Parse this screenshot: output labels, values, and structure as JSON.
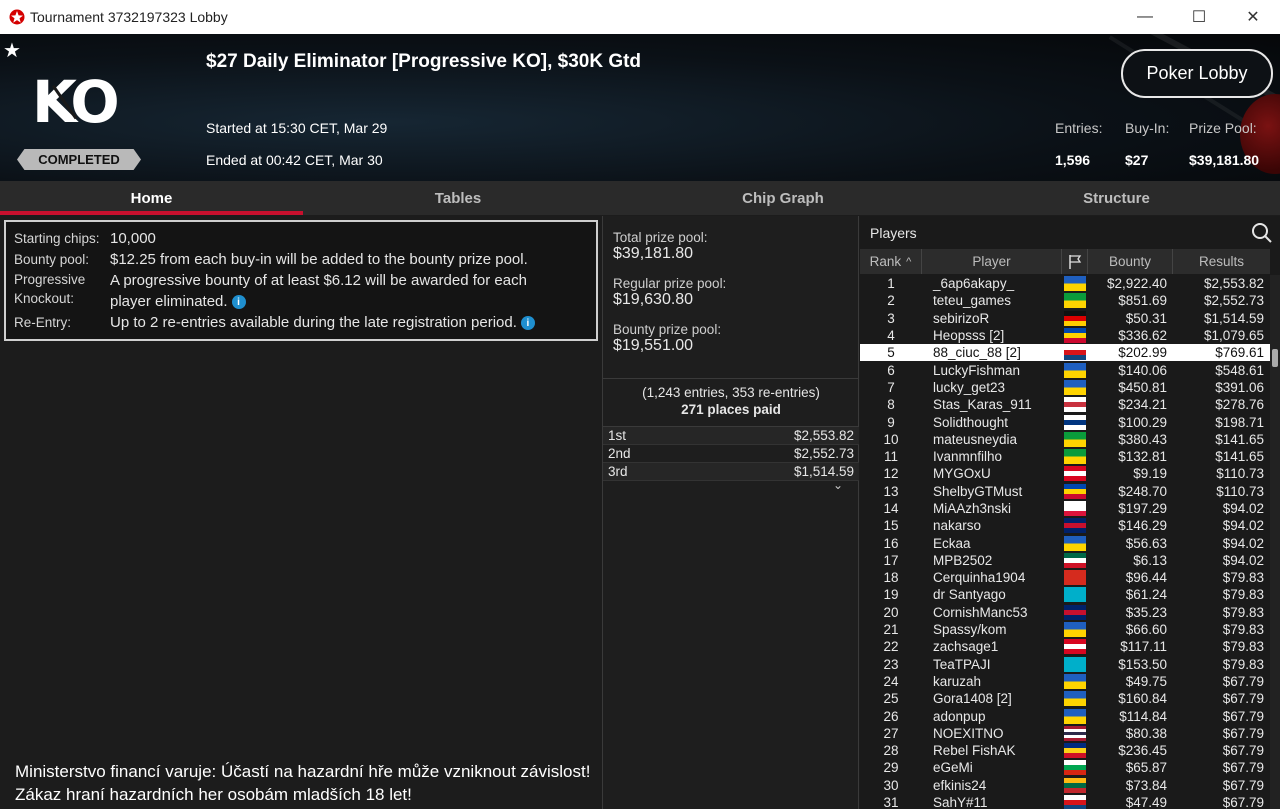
{
  "window": {
    "title": "Tournament 3732197323 Lobby",
    "minimize": "—",
    "maximize": "☐",
    "close": "✕"
  },
  "header": {
    "star": "★",
    "logo_text": "KO",
    "status_badge": "COMPLETED",
    "tournament_name": "$27 Daily Eliminator [Progressive KO], $30K Gtd",
    "started": "Started at 15:30 CET, Mar 29",
    "ended": "Ended at 00:42 CET, Mar 30",
    "lobby_button": "Poker Lobby",
    "stats": {
      "entries_label": "Entries:",
      "entries_value": "1,596",
      "buyin_label": "Buy-In:",
      "buyin_value": "$27",
      "prizepool_label": "Prize Pool:",
      "prizepool_value": "$39,181.80"
    }
  },
  "tabs": [
    "Home",
    "Tables",
    "Chip Graph",
    "Structure"
  ],
  "info": {
    "starting_chips_label": "Starting chips:",
    "starting_chips_value": "10,000",
    "bounty_pool_label": "Bounty pool:",
    "bounty_pool_value": "$12.25 from each buy-in will be added to the bounty prize pool.",
    "progressive_label_1": "Progressive",
    "progressive_label_2": "Knockout:",
    "progressive_value_1": "A progressive bounty of at least $6.12 will be awarded for each",
    "progressive_value_2": "player eliminated.",
    "reentry_label": "Re-Entry:",
    "reentry_value": "Up to 2 re-entries available during the late registration period.",
    "info_glyph": "i"
  },
  "warning": {
    "line1": "Ministerstvo financí varuje: Účastí na hazardní hře může vzniknout závislost!",
    "line2": "Zákaz hraní hazardních her osobám mladších 18 let!"
  },
  "prizes": {
    "total_label": "Total prize pool:",
    "total_value": "$39,181.80",
    "regular_label": "Regular prize pool:",
    "regular_value": "$19,630.80",
    "bounty_label": "Bounty prize pool:",
    "bounty_value": "$19,551.00",
    "entries_text": "(1,243 entries, 353 re-entries)",
    "places_paid": "271 places paid",
    "payouts": [
      {
        "place": "1st",
        "amount": "$2,553.82"
      },
      {
        "place": "2nd",
        "amount": "$2,552.73"
      },
      {
        "place": "3rd",
        "amount": "$1,514.59"
      }
    ],
    "chevron": "⌄"
  },
  "players": {
    "title": "Players",
    "columns": {
      "rank": "Rank",
      "sort_arrow": "^",
      "player": "Player",
      "bounty": "Bounty",
      "results": "Results"
    },
    "rows": [
      {
        "rank": "1",
        "player": "_6ap6akapy_",
        "flag": [
          "#1f5fbf",
          "#ffd400"
        ],
        "bounty": "$2,922.40",
        "results": "$2,553.82"
      },
      {
        "rank": "2",
        "player": "teteu_games",
        "flag": [
          "#0a9b3b",
          "#ffd400"
        ],
        "bounty": "$851.69",
        "results": "$2,552.73"
      },
      {
        "rank": "3",
        "player": "sebirizoR",
        "flag": [
          "#111111",
          "#dd0000",
          "#ffce00"
        ],
        "bounty": "$50.31",
        "results": "$1,514.59"
      },
      {
        "rank": "4",
        "player": "Heopsss [2]",
        "flag": [
          "#0046ae",
          "#ffd200",
          "#cc092f"
        ],
        "bounty": "$336.62",
        "results": "$1,079.65"
      },
      {
        "rank": "5",
        "player": "88_ciuc_88 [2]",
        "flag": [
          "#ffffff",
          "#d7141a",
          "#11457e"
        ],
        "bounty": "$202.99",
        "results": "$769.61",
        "highlight": true
      },
      {
        "rank": "6",
        "player": "LuckyFishman",
        "flag": [
          "#1f5fbf",
          "#ffd400"
        ],
        "bounty": "$140.06",
        "results": "$548.61"
      },
      {
        "rank": "7",
        "player": "lucky_get23",
        "flag": [
          "#1f5fbf",
          "#ffd400"
        ],
        "bounty": "$450.81",
        "results": "$391.06"
      },
      {
        "rank": "8",
        "player": "Stas_Karas_911",
        "flag": [
          "#ffffff",
          "#c8313e",
          "#ffffff"
        ],
        "bounty": "$234.21",
        "results": "$278.76"
      },
      {
        "rank": "9",
        "player": "Solidthought",
        "flag": [
          "#ffffff",
          "#003580",
          "#ffffff"
        ],
        "bounty": "$100.29",
        "results": "$198.71"
      },
      {
        "rank": "10",
        "player": "mateusneydia",
        "flag": [
          "#0a9b3b",
          "#ffd400"
        ],
        "bounty": "$380.43",
        "results": "$141.65"
      },
      {
        "rank": "11",
        "player": "Ivanmnfilho",
        "flag": [
          "#0a9b3b",
          "#ffd400"
        ],
        "bounty": "$132.81",
        "results": "$141.65"
      },
      {
        "rank": "12",
        "player": "MYGOxU",
        "flag": [
          "#d80621",
          "#ffffff",
          "#d80621"
        ],
        "bounty": "$9.19",
        "results": "$110.73"
      },
      {
        "rank": "13",
        "player": "ShelbyGTMust",
        "flag": [
          "#0046ae",
          "#ffd200",
          "#cc092f"
        ],
        "bounty": "$248.70",
        "results": "$110.73"
      },
      {
        "rank": "14",
        "player": "MiAAzh3nski",
        "flag": [
          "#ffffff",
          "#ffffff",
          "#dc143c"
        ],
        "bounty": "$197.29",
        "results": "$94.02"
      },
      {
        "rank": "15",
        "player": "nakarso",
        "flag": [
          "#012169",
          "#c8102e",
          "#012169"
        ],
        "bounty": "$146.29",
        "results": "$94.02"
      },
      {
        "rank": "16",
        "player": "Eckaa",
        "flag": [
          "#1f5fbf",
          "#ffd400"
        ],
        "bounty": "$56.63",
        "results": "$94.02"
      },
      {
        "rank": "17",
        "player": "MPB2502",
        "flag": [
          "#006847",
          "#ffffff",
          "#ce1126"
        ],
        "bounty": "$6.13",
        "results": "$94.02"
      },
      {
        "rank": "18",
        "player": "Cerquinha1904",
        "flag": [
          "#d52b1e",
          "#d52b1e"
        ],
        "bounty": "$96.44",
        "results": "$79.83"
      },
      {
        "rank": "19",
        "player": "dr Santyago",
        "flag": [
          "#00afca",
          "#00afca"
        ],
        "bounty": "$61.24",
        "results": "$79.83"
      },
      {
        "rank": "20",
        "player": "CornishManc53",
        "flag": [
          "#012169",
          "#c8102e",
          "#012169"
        ],
        "bounty": "$35.23",
        "results": "$79.83"
      },
      {
        "rank": "21",
        "player": "Spassy/kom",
        "flag": [
          "#1f5fbf",
          "#ffd400"
        ],
        "bounty": "$66.60",
        "results": "$79.83"
      },
      {
        "rank": "22",
        "player": "zachsage1",
        "flag": [
          "#d80621",
          "#ffffff",
          "#d80621"
        ],
        "bounty": "$117.11",
        "results": "$79.83"
      },
      {
        "rank": "23",
        "player": "TeaTPAJI",
        "flag": [
          "#00afca",
          "#00afca"
        ],
        "bounty": "$153.50",
        "results": "$79.83"
      },
      {
        "rank": "24",
        "player": "karuzah",
        "flag": [
          "#1f5fbf",
          "#ffd400"
        ],
        "bounty": "$49.75",
        "results": "$67.79"
      },
      {
        "rank": "25",
        "player": "Gora1408 [2]",
        "flag": [
          "#1f5fbf",
          "#ffd400"
        ],
        "bounty": "$160.84",
        "results": "$67.79"
      },
      {
        "rank": "26",
        "player": "adonpup",
        "flag": [
          "#1f5fbf",
          "#ffd400"
        ],
        "bounty": "$114.84",
        "results": "$67.79"
      },
      {
        "rank": "27",
        "player": "NOEXITNO",
        "flag": [
          "#a51931",
          "#ffffff",
          "#2d2a4a",
          "#ffffff",
          "#a51931"
        ],
        "bounty": "$80.38",
        "results": "$67.79"
      },
      {
        "rank": "28",
        "player": "Rebel FishAK",
        "flag": [
          "#002b7f",
          "#fcd116",
          "#ce1126"
        ],
        "bounty": "$236.45",
        "results": "$67.79"
      },
      {
        "rank": "29",
        "player": "eGeMi",
        "flag": [
          "#ffffff",
          "#00a651",
          "#d62612"
        ],
        "bounty": "$65.87",
        "results": "$67.79"
      },
      {
        "rank": "30",
        "player": "efkinis24",
        "flag": [
          "#fdb913",
          "#006a44",
          "#c1272d"
        ],
        "bounty": "$73.84",
        "results": "$67.79"
      },
      {
        "rank": "31",
        "player": "SahY#11",
        "flag": [
          "#ffffff",
          "#d7141a",
          "#11457e"
        ],
        "bounty": "$47.49",
        "results": "$67.79"
      }
    ]
  }
}
